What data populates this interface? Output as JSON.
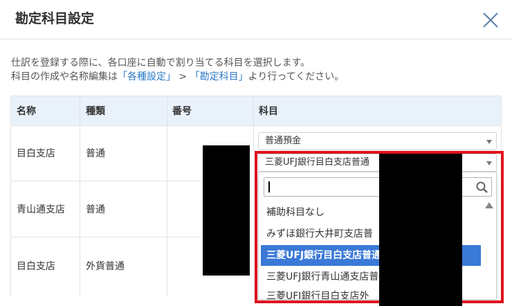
{
  "header": {
    "title": "勘定科目設定"
  },
  "description": {
    "line1": "仕訳を登録する際に、各口座に自動で割り当てる科目を選択します。",
    "line2_prefix": "科目の作成や名称編集は",
    "link1": "「各種設定」",
    "separator": ">",
    "link2": "「勘定科目」",
    "line2_suffix": "より行ってください。"
  },
  "table": {
    "columns": [
      "名称",
      "種類",
      "番号",
      "科目"
    ],
    "rows": [
      {
        "name": "目白支店",
        "type": "普通"
      },
      {
        "name": "青山通支店",
        "type": "普通"
      },
      {
        "name": "目白支店",
        "type": "外貨普通"
      }
    ]
  },
  "account_select": {
    "value": "普通預金"
  },
  "sub_account_select": {
    "value": "三菱UFJ銀行目白支店普通"
  },
  "dropdown": {
    "search_value": "",
    "options": [
      {
        "label": "補助科目なし",
        "selected": false
      },
      {
        "label": "みずほ銀行大井町支店普",
        "selected": false
      },
      {
        "label": "三菱UFJ銀行目白支店普通",
        "selected": true
      },
      {
        "label": "三菱UFJ銀行青山通支店普",
        "selected": false
      },
      {
        "label": "三菱UFJ銀行目白支店外",
        "selected": false
      }
    ]
  },
  "colors": {
    "header_bg": "#e9f1fa",
    "selected_bg": "#3b79d7",
    "link": "#2b78c8",
    "highlight": "#e0101d",
    "redaction": "#000000"
  },
  "icons": [
    "close-icon",
    "search-icon",
    "chevron-down-icon",
    "scroll-up-icon"
  ]
}
